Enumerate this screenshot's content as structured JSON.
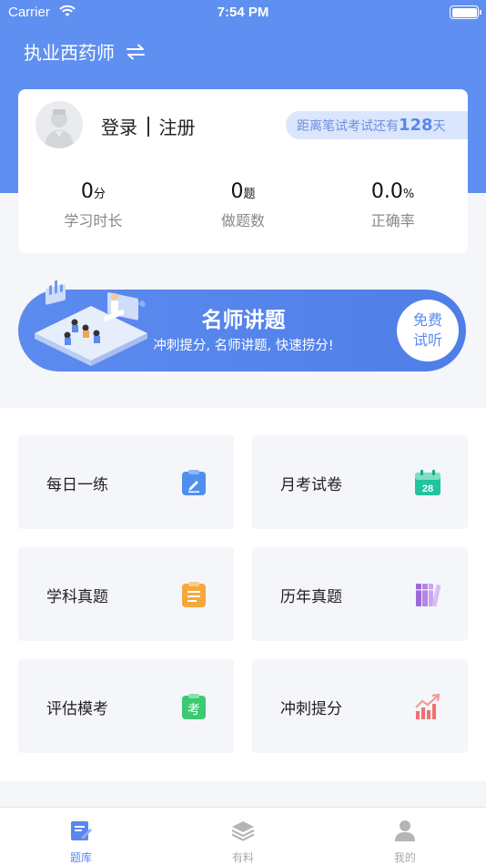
{
  "status_bar": {
    "carrier": "Carrier",
    "time": "7:54 PM"
  },
  "header": {
    "exam_name": "执业西药师"
  },
  "profile": {
    "login_label": "登录",
    "register_label": "注册",
    "countdown_prefix": "距离笔试考试还有",
    "countdown_days": "128",
    "countdown_suffix": "天",
    "stats": [
      {
        "value": "0",
        "unit": "分",
        "label": "学习时长"
      },
      {
        "value": "0",
        "unit": "题",
        "label": "做题数"
      },
      {
        "value": "0.0",
        "unit": "%",
        "label": "正确率"
      }
    ]
  },
  "banner": {
    "title": "名师讲题",
    "subtitle": "冲刺提分, 名师讲题, 快速捞分!",
    "cta": "免费试听"
  },
  "tiles": [
    {
      "label": "每日一练",
      "icon": "edit-note-icon",
      "color": "#4f8ff0"
    },
    {
      "label": "月考试卷",
      "icon": "calendar-28-icon",
      "color": "#21c4a0"
    },
    {
      "label": "学科真题",
      "icon": "clipboard-list-icon",
      "color": "#f7a83b"
    },
    {
      "label": "历年真题",
      "icon": "books-icon",
      "color": "#b385e6"
    },
    {
      "label": "评估模考",
      "icon": "exam-badge-icon",
      "color": "#3cc972"
    },
    {
      "label": "冲刺提分",
      "icon": "trending-up-chart-icon",
      "color": "#f07171"
    }
  ],
  "calendar_day": "28",
  "exam_char": "考",
  "tabbar": [
    {
      "label": "题库",
      "icon": "question-bank-icon",
      "active": true
    },
    {
      "label": "有料",
      "icon": "layers-icon",
      "active": false
    },
    {
      "label": "我的",
      "icon": "person-icon",
      "active": false
    }
  ],
  "colors": {
    "brand": "#5f8ff0",
    "accent_text": "#5a86ee"
  }
}
